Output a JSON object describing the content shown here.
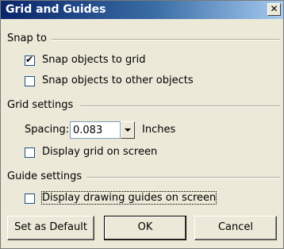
{
  "window": {
    "title": "Grid and Guides",
    "close_glyph": "✕"
  },
  "snap_to": {
    "header": "Snap to",
    "snap_objects_to_grid": {
      "label": "Snap objects to grid",
      "checked": true
    },
    "snap_objects_to_other_objects": {
      "label": "Snap objects to other objects",
      "checked": false
    }
  },
  "grid_settings": {
    "header": "Grid settings",
    "spacing_label": "Spacing:",
    "spacing_value": "0.083",
    "unit": "Inches",
    "display_grid": {
      "label": "Display grid on screen",
      "checked": false
    }
  },
  "guide_settings": {
    "header": "Guide settings",
    "display_guides": {
      "label": "Display drawing guides on screen",
      "checked": false
    }
  },
  "buttons": {
    "set_default": "Set as Default",
    "ok": "OK",
    "cancel": "Cancel"
  },
  "colors": {
    "title_bar_start": "#0a246a",
    "title_bar_end": "#a6caf0",
    "dialog_bg": "#ece9d8"
  },
  "icons": {
    "close": "close-icon",
    "dropdown": "chevron-down-icon"
  }
}
